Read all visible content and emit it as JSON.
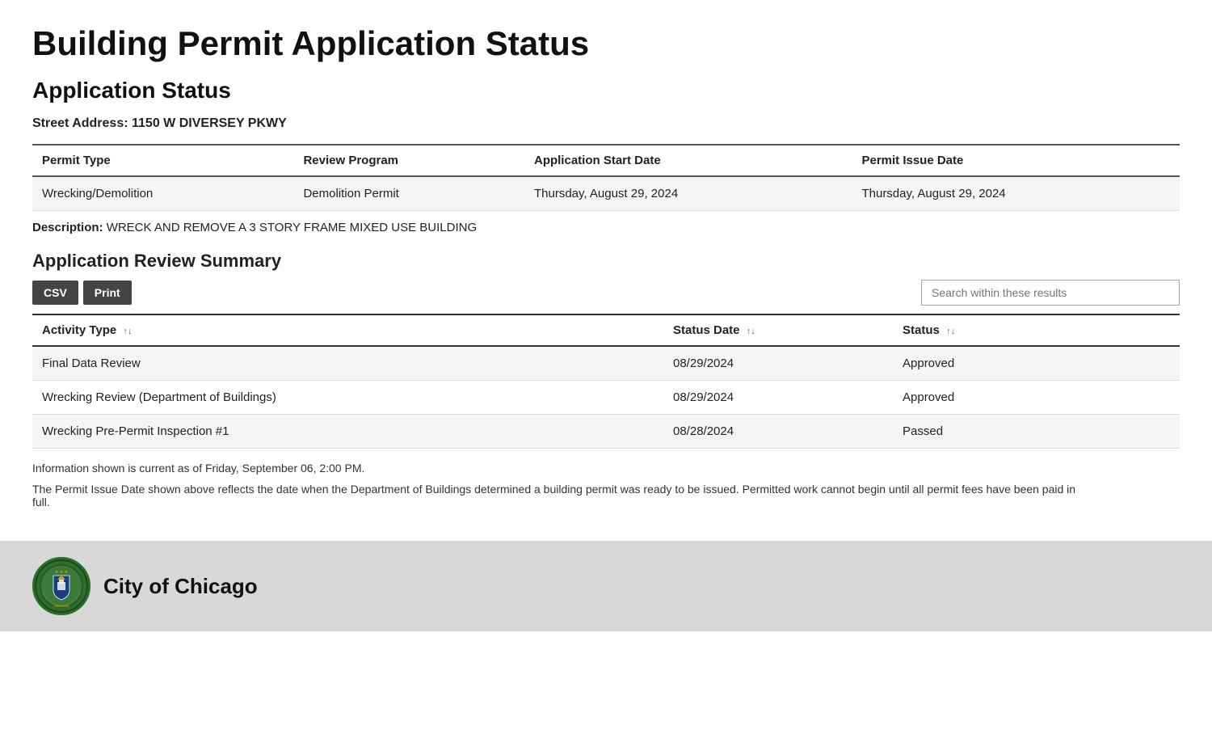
{
  "page": {
    "title": "Building Permit Application Status",
    "section_title": "Application Status",
    "street_address_label": "Street Address:",
    "street_address_value": "1150 W DIVERSEY PKWY"
  },
  "permit_table": {
    "headers": [
      "Permit Type",
      "Review Program",
      "Application Start Date",
      "Permit Issue Date"
    ],
    "rows": [
      {
        "permit_type": "Wrecking/Demolition",
        "review_program": "Demolition Permit",
        "application_start_date": "Thursday, August 29, 2024",
        "permit_issue_date": "Thursday, August 29, 2024"
      }
    ]
  },
  "description": {
    "label": "Description:",
    "value": "WRECK AND REMOVE A 3 STORY FRAME MIXED USE BUILDING"
  },
  "review_summary": {
    "title": "Application Review Summary",
    "csv_button": "CSV",
    "print_button": "Print",
    "search_placeholder": "Search within these results",
    "table_headers": {
      "activity_type": "Activity Type",
      "status_date": "Status Date",
      "status": "Status"
    },
    "rows": [
      {
        "activity_type": "Final Data Review",
        "status_date": "08/29/2024",
        "status": "Approved"
      },
      {
        "activity_type": "Wrecking Review (Department of Buildings)",
        "status_date": "08/29/2024",
        "status": "Approved"
      },
      {
        "activity_type": "Wrecking Pre-Permit Inspection #1",
        "status_date": "08/28/2024",
        "status": "Passed"
      }
    ]
  },
  "notes": {
    "current_as_of": "Information shown is current as of Friday, September 06, 2:00 PM.",
    "permit_issue_note": "The Permit Issue Date shown above reflects the date when the Department of Buildings determined a building permit was ready to be issued. Permitted work cannot begin until all permit fees have been paid in full."
  },
  "footer": {
    "city_name": "City of Chicago"
  }
}
